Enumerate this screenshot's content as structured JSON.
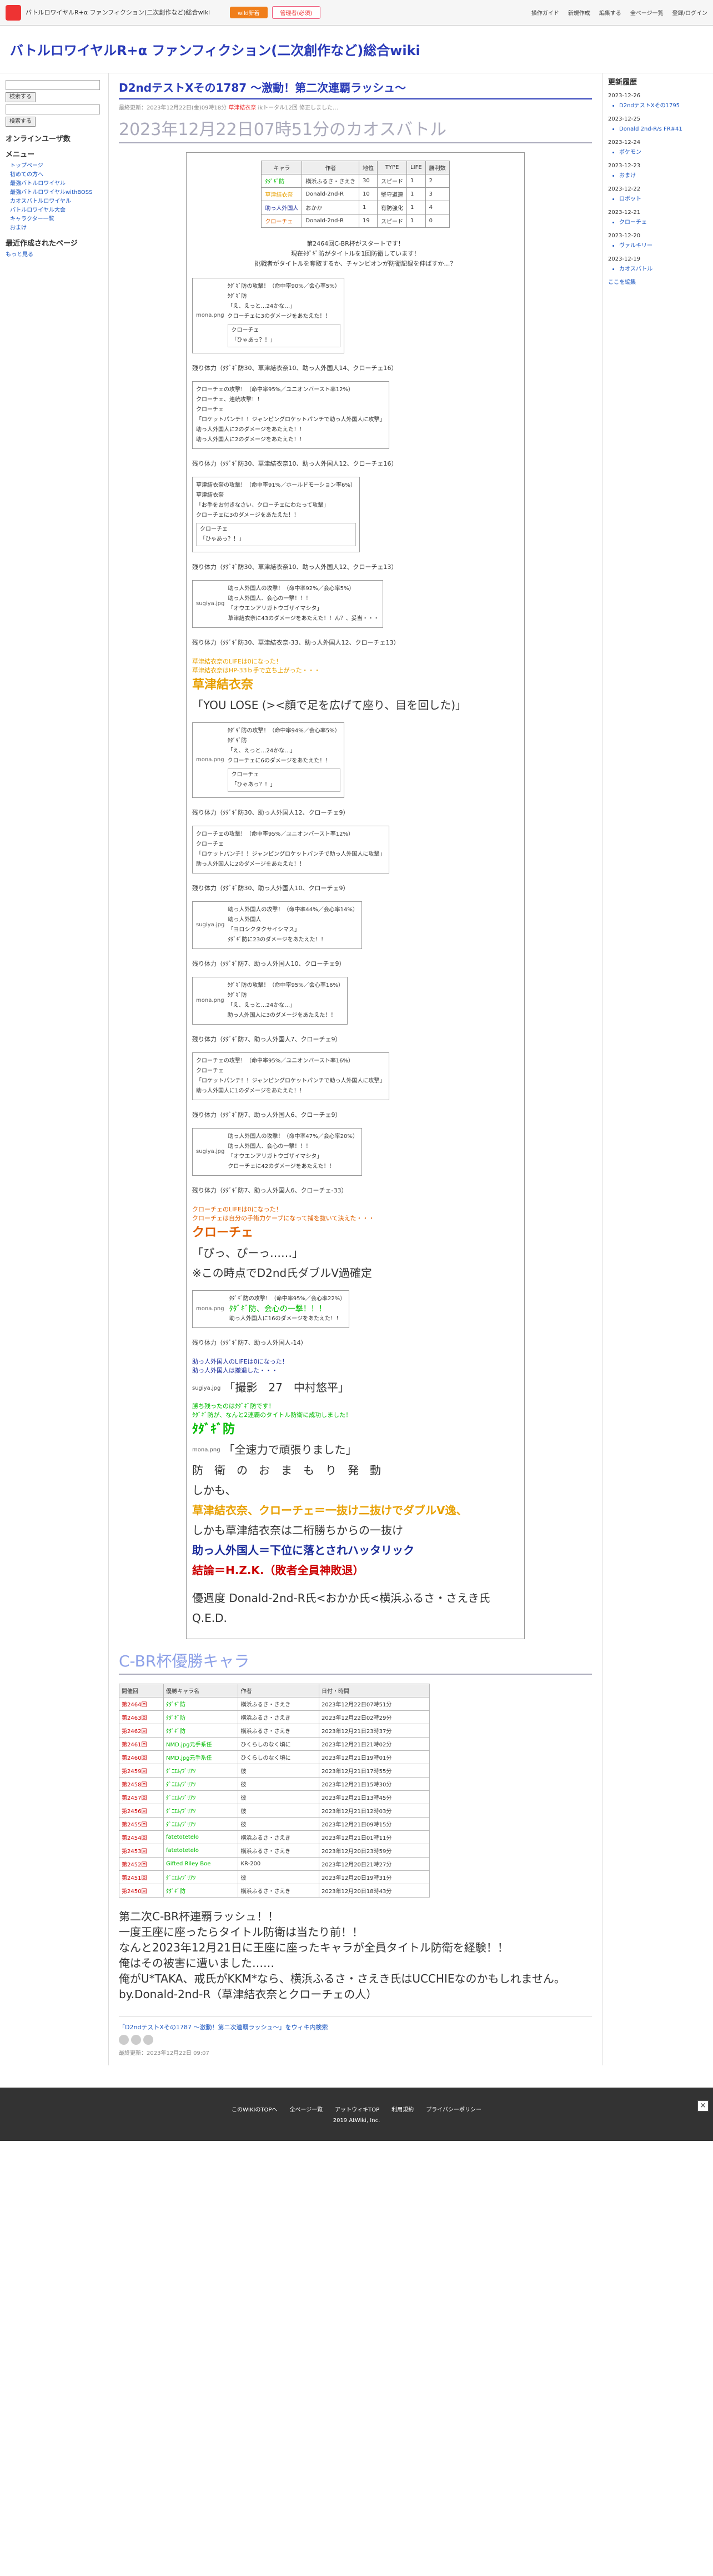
{
  "topbar": {
    "site": "バトルロワイヤルR+α ファンフィクション(二次創作など)総合wiki",
    "btn1": "wiki新着",
    "btn2": "管理者(必須)",
    "nav": [
      "操作ガイド",
      "新規作成",
      "編集する",
      "全ページ一覧",
      "登録/ログイン"
    ]
  },
  "header": {
    "title": "バトルロワイヤルR+α ファンフィクション(二次創作など)総合wiki"
  },
  "lsb": {
    "search_btn1": "検索する",
    "search_btn2": "検索する",
    "online": "オンラインユーザ数",
    "menu": "メニュー",
    "recent": "最近作成されたページ",
    "items": [
      "トップページ",
      "初めての方へ",
      "最強バトルロワイヤル",
      "最強バトルロワイヤルwithBOSS",
      "カオスバトルロワイヤル",
      "バトルロワイヤル大会",
      "キャラクター一覧",
      "おまけ"
    ],
    "more": "もっと見る"
  },
  "page": {
    "title": "D2ndテストXその1787 〜激動！第二次連覇ラッシュ〜",
    "meta_pre": "最終更新：2023年12月22日(金)09時18分",
    "meta_author": "草津結衣奈",
    "meta_post": "ikトータル12回 修正しました…",
    "h1": "2023年12月22日07時51分のカオスバトル"
  },
  "table": {
    "headers": [
      "キャラ",
      "作者",
      "地位",
      "TYPE",
      "LIFE",
      "勝利数"
    ],
    "rows": [
      [
        "ﾀﾀﾞｷﾞ防",
        "横浜ふるさ・さえき",
        "30",
        "スピード",
        "1",
        "2"
      ],
      [
        "草津結衣奈",
        "Donald-2nd-R",
        "10",
        "堅守道連",
        "1",
        "3"
      ],
      [
        "助っ人外国人",
        "おかか",
        "1",
        "有防強化",
        "1",
        "4"
      ],
      [
        "クローチェ",
        "Donald-2nd-R",
        "19",
        "スピード",
        "1",
        "0"
      ]
    ]
  },
  "intro": [
    "第2464回C-BR杯がスタートです！",
    "現在ﾀﾀﾞｷﾞ防がタイトルを1回防衛しています！",
    "挑戦者がタイトルを奪取するか、チャンピオンが防衛記録を伸ばすか…？"
  ],
  "battle": [
    {
      "img": "mona.png",
      "lines": [
        "ﾀﾀﾞｷﾞ防の攻撃！（命中率90%／会心率5%）",
        "ﾀﾀﾞｷﾞ防",
        "「え、えっと…24かな…」",
        "クローチェに3のダメージをあたえた！！"
      ],
      "reply": [
        "クローチェ",
        "「ひゃあっ？！」"
      ],
      "remain": "残り体力（ﾀﾀﾞｷﾞ防30、草津結衣奈10、助っ人外国人14、クローチェ16）"
    },
    {
      "img": "",
      "lines": [
        "クローチェの攻撃！（命中率95%／ユニオンバースト率12%）",
        "クローチェ、連続攻撃！！",
        "クローチェ",
        "「ロケットパンチ！！ジャンピングロケットパンチで助っ人外国人に攻撃」",
        "助っ人外国人に2のダメージをあたえた！！",
        "助っ人外国人に2のダメージをあたえた！！"
      ],
      "reply": [],
      "remain": "残り体力（ﾀﾀﾞｷﾞ防30、草津結衣奈10、助っ人外国人12、クローチェ16）"
    },
    {
      "img": "",
      "lines": [
        "草津結衣奈の攻撃！（命中率91%／ホールドモーション率6%）",
        "草津結衣奈",
        "「お手をお付きなさい、クローチェにわたって攻撃」",
        "クローチェに3のダメージをあたえた！！"
      ],
      "reply": [
        "クローチェ",
        "「ひゃあっ？！」"
      ],
      "remain": "残り体力（ﾀﾀﾞｷﾞ防30、草津結衣奈10、助っ人外国人12、クローチェ13）"
    },
    {
      "img": "sugiya.jpg",
      "lines": [
        "助っ人外国人の攻撃！（命中率92%／会心率5%）",
        "助っ人外国人、会心の一撃！！！",
        "「オウエンアリガトウゴザイマシタ」",
        "草津結衣奈に43のダメージをあたえた！！ん？、妥当・・・"
      ],
      "reply": [],
      "remain": "残り体力（ﾀﾀﾞｷﾞ防30、草津結衣奈-33、助っ人外国人12、クローチェ13）"
    }
  ],
  "lose": {
    "pre": "草津結衣奈のLIFEは0になった！",
    "pre2": "草津結衣奈はHP-33ｂ手で立ち上がった・・・",
    "name": "草津結衣奈",
    "quote": "「YOU LOSE (><顔で足を広げて座り、目を回した)」"
  },
  "battle2": [
    {
      "img": "mona.png",
      "lines": [
        "ﾀﾀﾞｷﾞ防の攻撃！（命中率94%／会心率5%）",
        "ﾀﾀﾞｷﾞ防",
        "「え、えっと…24かな…」",
        "クローチェに6のダメージをあたえた！！"
      ],
      "reply": [
        "クローチェ",
        "「ひゃあっ？！」"
      ],
      "remain": "残り体力（ﾀﾀﾞｷﾞ防30、助っ人外国人12、クローチェ9）"
    },
    {
      "img": "",
      "lines": [
        "クローチェの攻撃！（命中率95%／ユニオンバースト率12%）",
        "クローチェ",
        "「ロケットパンチ！！ジャンピングロケットパンチで助っ人外国人に攻撃」",
        "助っ人外国人に2のダメージをあたえた！！"
      ],
      "reply": [],
      "remain": "残り体力（ﾀﾀﾞｷﾞ防30、助っ人外国人10、クローチェ9）"
    },
    {
      "img": "sugiya.jpg",
      "lines": [
        "助っ人外国人の攻撃！（命中率44%／会心率14%）",
        "助っ人外国人",
        "「ヨロシクタクサイシマス」",
        "ﾀﾀﾞｷﾞ防に23のダメージをあたえた！！"
      ],
      "reply": [],
      "remain": "残り体力（ﾀﾀﾞｷﾞ防7、助っ人外国人10、クローチェ9）"
    },
    {
      "img": "mona.png",
      "lines": [
        "ﾀﾀﾞｷﾞ防の攻撃！（命中率95%／会心率16%）",
        "ﾀﾀﾞｷﾞ防",
        "「え、えっと…24かな…」",
        "助っ人外国人に3のダメージをあたえた！！"
      ],
      "reply": [],
      "remain": "残り体力（ﾀﾀﾞｷﾞ防7、助っ人外国人7、クローチェ9）"
    },
    {
      "img": "",
      "lines": [
        "クローチェの攻撃！（命中率95%／ユニオンバースト率16%）",
        "クローチェ",
        "「ロケットパンチ！！ジャンピングロケットパンチで助っ人外国人に攻撃」",
        "助っ人外国人に1のダメージをあたえた！！"
      ],
      "reply": [],
      "remain": "残り体力（ﾀﾀﾞｷﾞ防7、助っ人外国人6、クローチェ9）"
    },
    {
      "img": "sugiya.jpg",
      "lines": [
        "助っ人外国人の攻撃！（命中率47%／会心率20%）",
        "助っ人外国人、会心の一撃！！！",
        "「オウエンアリガトウゴザイマシタ」",
        "クローチェに42のダメージをあたえた！！"
      ],
      "reply": [],
      "remain": "残り体力（ﾀﾀﾞｷﾞ防7、助っ人外国人6、クローチェ-33）"
    }
  ],
  "lose2": {
    "pre": "クローチェのLIFEは0になった！",
    "pre2": "クローチェは自分の手術力ケーブになって捕を抜いて決えた・・・",
    "name": "クローチェ",
    "quote": "「ぴっ、ぴーっ……」",
    "note": "※この時点でD2nd氏ダブルV過確定"
  },
  "battle3": {
    "img": "mona.png",
    "lines": [
      "ﾀﾀﾞｷﾞ防の攻撃！（命中率95%／会心率22%）",
      "ﾀﾀﾞｷﾞ防、会心の一撃！！！",
      "助っ人外国人に16のダメージをあたえた！！"
    ],
    "remain": "残り体力（ﾀﾀﾞｷﾞ防7、助っ人外国人-14）"
  },
  "final": {
    "l1": "助っ人外国人のLIFEは0になった！",
    "l2": "助っ人外国人は撤退した・・・",
    "img": "sugiya.jpg",
    "caption": "「撮影　27　中村悠平」",
    "win1": "勝ち残ったのはﾀﾀﾞｷﾞ防です！",
    "win2": "ﾀﾀﾞｷﾞ防が、なんと2連覇のタイトル防衛に成功しました！",
    "win_name": "ﾀﾀﾞｷﾞ防",
    "win_img": "mona.png",
    "win_quote": "「全速力で頑張りました」",
    "conc1": "防　衛　の　お　ま　も　り　発　動",
    "conc2": "しかも、",
    "conc3": "草津結衣奈、クローチェ＝一抜け二抜けでダブルV逸、",
    "conc4": "しかも草津結衣奈は二桁勝ちからの一抜け",
    "conc5": "助っ人外国人＝下位に落とされハッタリック",
    "conc6": "結論＝H.Z.K.（敗者全員神敗退）",
    "conc7": "優週度 Donald-2nd-R氏<おかか氏<横浜ふるさ・さえき氏",
    "conc8": "Q.E.D."
  },
  "champ": {
    "title": "C-BR杯優勝キャラ",
    "headers": [
      "開催回",
      "優勝キャラ名",
      "作者",
      "日付・時間"
    ],
    "rows": [
      [
        "第2464回",
        "ﾀﾀﾞｷﾞ防",
        "横浜ふるさ・さえき",
        "2023年12月22日07時51分"
      ],
      [
        "第2463回",
        "ﾀﾀﾞｷﾞ防",
        "横浜ふるさ・さえき",
        "2023年12月22日02時29分"
      ],
      [
        "第2462回",
        "ﾀﾀﾞｷﾞ防",
        "横浜ふるさ・さえき",
        "2023年12月21日23時37分"
      ],
      [
        "第2461回",
        "NMD.jpg元手系任",
        "ひくらしのなく頃に",
        "2023年12月21日21時02分"
      ],
      [
        "第2460回",
        "NMD.jpg元手系任",
        "ひくらしのなく頃に",
        "2023年12月21日19時01分"
      ],
      [
        "第2459回",
        "ﾀﾞﾆｴﾙ/ﾌﾞﾘｱﾂ",
        "彼",
        "2023年12月21日17時55分"
      ],
      [
        "第2458回",
        "ﾀﾞﾆｴﾙ/ﾌﾞﾘｱﾂ",
        "彼",
        "2023年12月21日15時30分"
      ],
      [
        "第2457回",
        "ﾀﾞﾆｴﾙ/ﾌﾞﾘｱﾂ",
        "彼",
        "2023年12月21日13時45分"
      ],
      [
        "第2456回",
        "ﾀﾞﾆｴﾙ/ﾌﾞﾘｱﾂ",
        "彼",
        "2023年12月21日12時03分"
      ],
      [
        "第2455回",
        "ﾀﾞﾆｴﾙ/ﾌﾞﾘｱﾂ",
        "彼",
        "2023年12月21日09時15分"
      ],
      [
        "第2454回",
        "fatetotetelo",
        "横浜ふるさ・さえき",
        "2023年12月21日01時11分"
      ],
      [
        "第2453回",
        "fatetotetelo",
        "横浜ふるさ・さえき",
        "2023年12月20日23時59分"
      ],
      [
        "第2452回",
        "Gifted Riley Boe",
        "KR-200",
        "2023年12月20日21時27分"
      ],
      [
        "第2451回",
        "ﾀﾞﾆｴﾙ/ﾌﾞﾘｱﾂ",
        "彼",
        "2023年12月20日19時31分"
      ],
      [
        "第2450回",
        "ﾀﾀﾞｷﾞ防",
        "横浜ふるさ・さえき",
        "2023年12月20日18時43分"
      ]
    ]
  },
  "ending": [
    "第二次C-BR杯連覇ラッシュ！！",
    "一度王座に座ったらタイトル防衛は当たり前！！",
    "なんと2023年12月21日に王座に座ったキャラが全員タイトル防衛を経験！！",
    "俺はその被害に遭いました……",
    "俺がU*TAKA、戒氏がKKM*なら、横浜ふるさ・さえき氏はUCCHIEなのかもしれません。",
    "by.Donald-2nd-R（草津結衣奈とクローチェの人）"
  ],
  "footerlink": "「D2ndテストXその1787 〜激動！第二次連覇ラッシュ〜」をウィキ内検索",
  "lastedit": "最終更新：2023年12月22日 09:07",
  "rsb": {
    "title": "更新履歴",
    "dates": [
      "2023-12-26",
      "2023-12-25",
      "2023-12-24",
      "2023-12-23",
      "2023-12-22",
      "2023-12-21",
      "2023-12-20",
      "2023-12-19"
    ],
    "items": [
      "D2ndテストXその1795",
      "Donald 2nd-R/s FR#41",
      "ポケモン",
      "おまけ",
      "ロボット",
      "クローチェ",
      "ヴァルキリー",
      "カオスバトル"
    ],
    "more": "ここを編集"
  },
  "footer": {
    "links": [
      "このWIKIのTOPへ",
      "全ページ一覧",
      "アットウィキTOP",
      "利用規約",
      "プライバシーポリシー"
    ],
    "copy": "2019 AtWiki, Inc."
  }
}
